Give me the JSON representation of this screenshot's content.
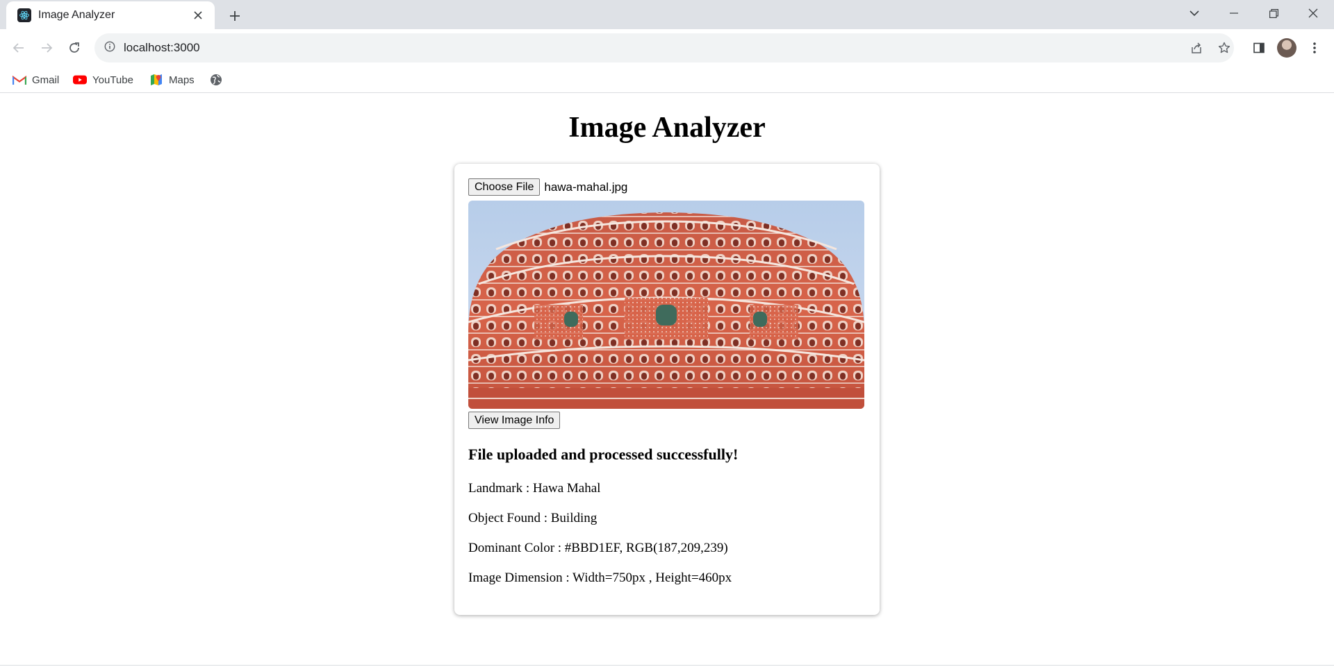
{
  "browser": {
    "tab_title": "Image Analyzer",
    "url": "localhost:3000",
    "bookmarks": [
      {
        "label": "Gmail",
        "icon": "gmail-icon"
      },
      {
        "label": "YouTube",
        "icon": "youtube-icon"
      },
      {
        "label": "Maps",
        "icon": "maps-icon"
      },
      {
        "label": "",
        "icon": "globe-icon"
      }
    ]
  },
  "page": {
    "title": "Image Analyzer",
    "choose_file_label": "Choose File",
    "file_name": "hawa-mahal.jpg",
    "view_button_label": "View Image Info",
    "status": "File uploaded and processed successfully!",
    "results": {
      "landmark": "Landmark : Hawa Mahal",
      "object": "Object Found : Building",
      "color": "Dominant Color : #BBD1EF, RGB(187,209,239)",
      "dimension": "Image Dimension : Width=750px , Height=460px"
    }
  },
  "colors": {
    "sky": "#BBD1EF",
    "facade": "#d8644a",
    "chrome": "#dee1e6"
  }
}
